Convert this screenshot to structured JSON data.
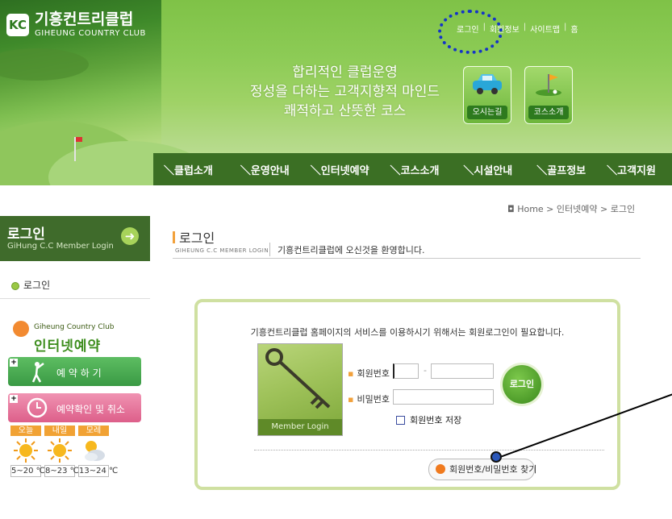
{
  "header": {
    "logo_mark": "KC",
    "logo_kr": "기흥컨트리클럽",
    "logo_en": "GIHEUNG COUNTRY CLUB",
    "top_links": [
      "로그인",
      "회원정보",
      "사이트맵",
      "홈"
    ],
    "slogan": [
      "합리적인 클럽운영",
      "정성을 다하는 고객지향적 마인드",
      "쾌적하고 산뜻한 코스"
    ],
    "quick": [
      {
        "label": "오시는길",
        "icon": "car-icon"
      },
      {
        "label": "코스소개",
        "icon": "golf-flag-icon"
      }
    ],
    "gnb": [
      "클럽소개",
      "운영안내",
      "인터넷예약",
      "코스소개",
      "시설안내",
      "골프정보",
      "고객지원"
    ]
  },
  "sidebar": {
    "login_title": "로그인",
    "login_sub": "GiHung C.C Member Login",
    "sub_menu": "로그인",
    "club_en": "Giheung Country Club",
    "club_kr": "인터넷예약",
    "reserve_label": "예 약 하 기",
    "cancel_label": "예약확인 및 취소",
    "weather": [
      {
        "day": "오늘",
        "temp": "5~20 ℃",
        "icon": "sun-icon"
      },
      {
        "day": "내일",
        "temp": "8~23 ℃",
        "icon": "sun-icon"
      },
      {
        "day": "모레",
        "temp": "13~24 ℃",
        "icon": "cloud-sun-icon"
      }
    ]
  },
  "main": {
    "breadcrumb": "Home > 인터넷예약 > 로그인",
    "title": "로그인",
    "title_sub_en": "GIHEUNG C.C MEMBER LOGIN",
    "title_sub_kr": "기흥컨트리클럽에 오신것을 환영합니다.",
    "panel_message": "기흥컨트리클럽 홈페이지의 서비스를 이용하시기 위해서는 회원로그인이 필요합니다.",
    "key_caption": "Member Login",
    "id_label": "회원번호",
    "pw_label": "비밀번호",
    "save_label": "회원번호 저장",
    "login_button": "로그인",
    "find_button": "회원번호/비밀번호 찾기"
  }
}
